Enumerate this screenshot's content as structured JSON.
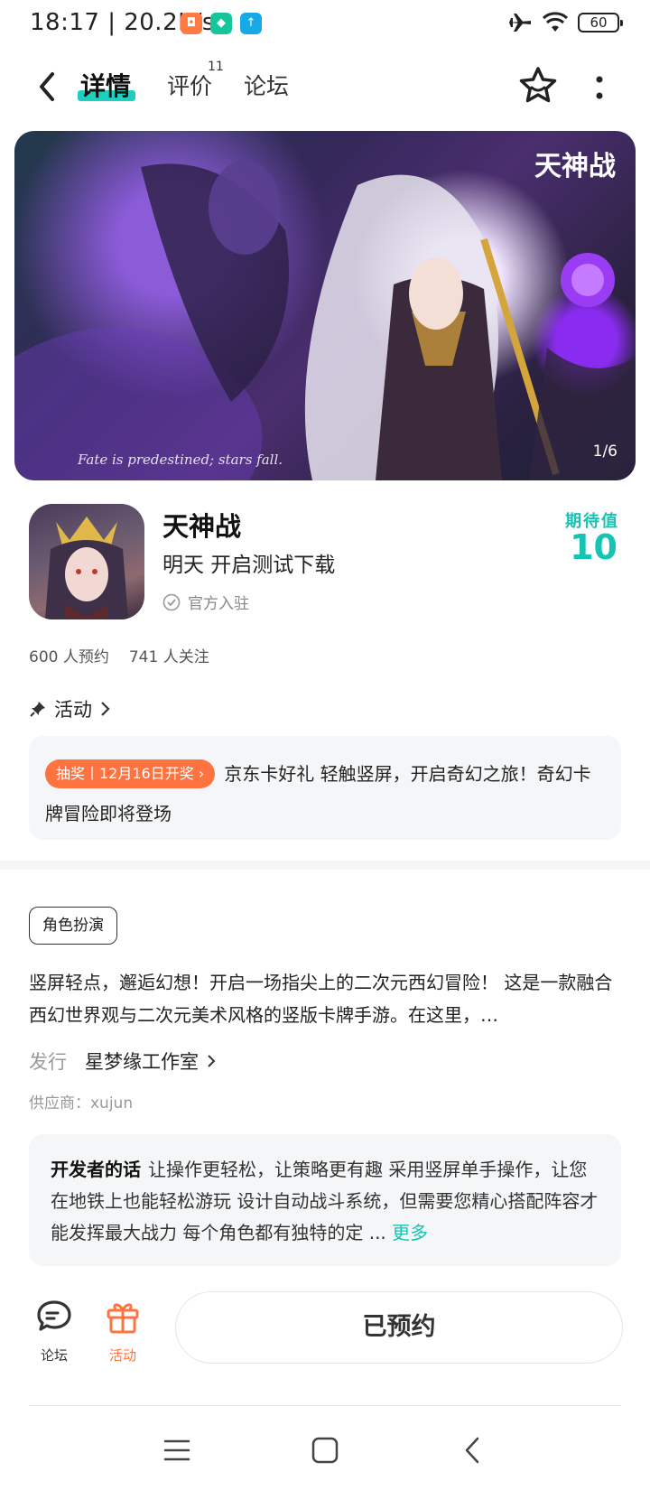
{
  "status_bar": {
    "time_speed": "18:17 | 20.2K/s",
    "battery": "60",
    "colors": {
      "app1": "#ff7a45",
      "app2": "#16c59a",
      "app3": "#17a8e6"
    }
  },
  "nav": {
    "tabs": [
      {
        "label": "详情",
        "active": true
      },
      {
        "label": "评价",
        "badge": "11"
      },
      {
        "label": "论坛"
      }
    ]
  },
  "banner": {
    "logo_text": "天神战",
    "caption": "Fate is predestined; stars fall.",
    "pager": "1/6"
  },
  "app": {
    "name": "天神战",
    "status": "明天 开启测试下载",
    "official": "官方入驻",
    "expect_label": "期待值",
    "expect_value": "10"
  },
  "stats": {
    "reservations": "600 人预约",
    "followers": "741 人关注"
  },
  "activity": {
    "heading": "活动",
    "tag": "抽奖丨12月16日开奖",
    "text": "京东卡好礼 轻触竖屏，开启奇幻之旅！奇幻卡牌冒险即将登场"
  },
  "details": {
    "genre": "角色扮演",
    "description": "竖屏轻点，邂逅幻想！开启一场指尖上的二次元西幻冒险！ 这是一款融合西幻世界观与二次元美术风格的竖版卡牌手游。在这里，…",
    "publisher_label": "发行",
    "publisher_name": "星梦缘工作室",
    "supplier": "供应商：xujun"
  },
  "developer_note": {
    "title": "开发者的话",
    "text": "让操作更轻松，让策略更有趣 采用竖屏单手操作，让您在地铁上也能轻松游玩 设计自动战斗系统，但需要您精心搭配阵容才能发挥最大战力 每个角色都有独特的定 ...",
    "more": "更多"
  },
  "bottom_bar": {
    "forum_label": "论坛",
    "activity_label": "活动",
    "reserve_label": "已预约",
    "colors": {
      "accent": "#17c3b2",
      "activity": "#ff7340"
    }
  }
}
